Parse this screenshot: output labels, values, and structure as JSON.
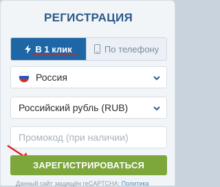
{
  "registration": {
    "title": "РЕГИСТРАЦИЯ",
    "tabs": [
      {
        "label": "В 1 клик",
        "icon": "lightning-icon",
        "active": true
      },
      {
        "label": "По телефону",
        "icon": "phone-icon",
        "active": false
      }
    ],
    "country": {
      "value": "Россия",
      "icon": "russia-flag-icon"
    },
    "currency": {
      "value": "Российский рубль (RUB)"
    },
    "promo": {
      "placeholder": "Промокод (при наличии)"
    },
    "submit_label": "ЗАРЕГИСТРИРОВАТЬСЯ",
    "footer": {
      "text": "Данный сайт защищён reCAPTCHA: ",
      "link": "Политика"
    }
  },
  "colors": {
    "accent": "#1f66a6",
    "button": "#7da63b",
    "highlight": "#e02020"
  }
}
